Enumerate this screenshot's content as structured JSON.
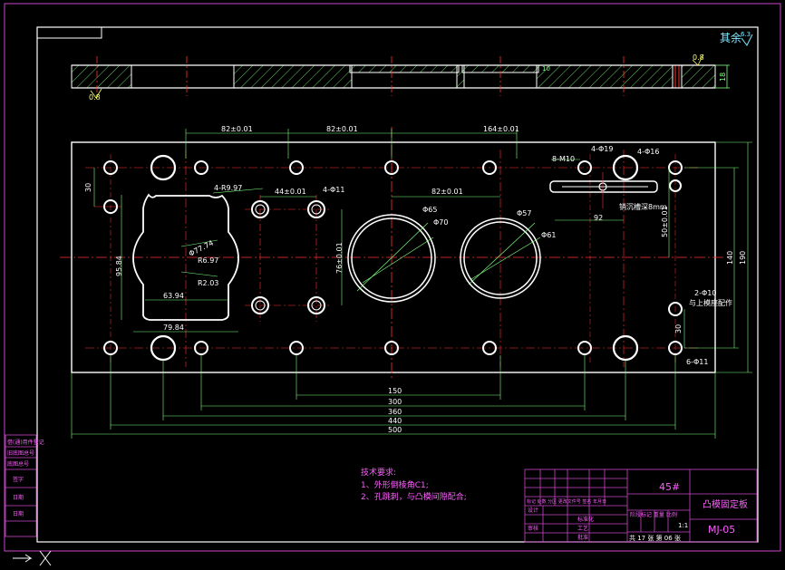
{
  "title_block": {
    "material": "45#",
    "part_name": "凸模固定板",
    "drawing_no": "MJ-05",
    "scale": "1:1",
    "sheet": "共 17 张  第 06 张",
    "hdr_row": "标记 处数 分区 更改文件号 签名 年月日",
    "design": "设计",
    "standard": "标准化",
    "review": "审核",
    "process": "工艺",
    "approve": "批准",
    "stage_hdr": "阶段标记 重量 比例"
  },
  "left_strip": [
    "借(通)用件登记",
    "旧底图总号",
    "底图总号",
    "签字",
    "日期",
    "日期"
  ],
  "roughness_note": "其余",
  "roughness_val": "6.3",
  "tech_req": {
    "heading": "技术要求:",
    "line1": "1、外形倒棱角C1;",
    "line2": "2、孔跳刺，与凸模间隙配合;"
  },
  "section": {
    "ra_left": "0.8",
    "ra_right": "0.8",
    "dim_thk": "18",
    "dim_small": "10"
  },
  "dims": {
    "d_82a": "82±0.01",
    "d_82b": "82±0.01",
    "d_164": "164±0.01",
    "d_30": "30",
    "d_r997": "4-R9.97",
    "d_44": "44±0.01",
    "d_phi11": "4-Φ11",
    "d_82c": "82±0.01",
    "d_m10": "8-M10",
    "d_phi19": "4-Φ19",
    "d_phi16": "4-Φ16",
    "d_phi65": "Φ65",
    "d_phi70": "Φ70",
    "d_phi57": "Φ57",
    "d_phi61": "Φ61",
    "d_slot_note": "销沉槽深8mm",
    "d_92": "92",
    "d_50": "50±0.01",
    "d_7774": "Φ77.74",
    "d_958": "95.84",
    "d_r697": "R6.97",
    "d_r203": "R2.03",
    "d_7650": "76±0.01",
    "d_6394": "63.94",
    "d_7984": "79.84",
    "d_140": "140",
    "d_190": "190",
    "d_phi10": "2-Φ10",
    "d_phi10_note": "与上模座配作",
    "d_30b": "30",
    "d_phi11b": "6-Φ11",
    "d_150": "150",
    "d_300": "300",
    "d_360": "360",
    "d_440": "440",
    "d_500": "500"
  },
  "colors": {
    "outline": "#ffffff",
    "dimension": "#7dff7d",
    "centerline": "#ff3030",
    "frame": "#cc44cc",
    "text_magenta": "#ff5cff",
    "hatch": "#7dff7d"
  }
}
